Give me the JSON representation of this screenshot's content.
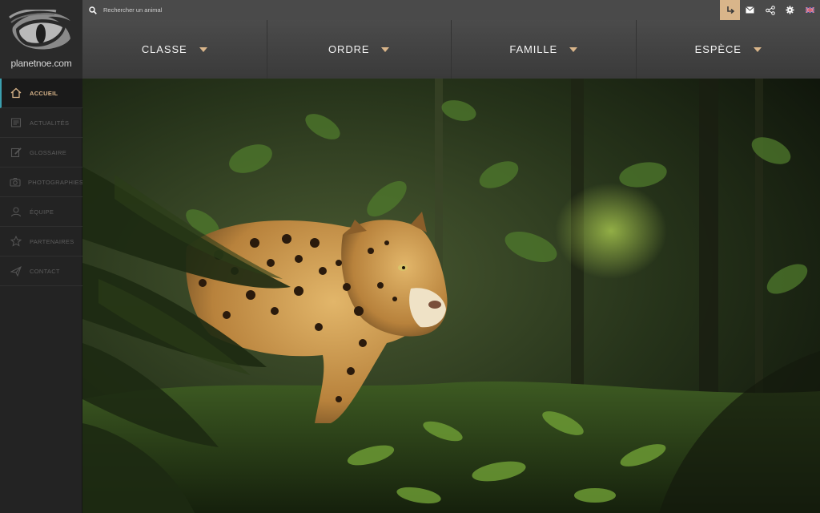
{
  "logo": {
    "text": "planetnoe.com"
  },
  "sidebar": {
    "items": [
      {
        "label": "ACCUEIL",
        "icon": "home-icon",
        "active": true
      },
      {
        "label": "ACTUALITÉS",
        "icon": "news-icon"
      },
      {
        "label": "GLOSSAIRE",
        "icon": "edit-icon"
      },
      {
        "label": "PHOTOGRAPHIES",
        "icon": "camera-icon"
      },
      {
        "label": "ÉQUIPE",
        "icon": "user-icon"
      },
      {
        "label": "PARTENAIRES",
        "icon": "star-icon"
      },
      {
        "label": "CONTACT",
        "icon": "send-icon"
      }
    ]
  },
  "search": {
    "placeholder": "Rechercher un animal"
  },
  "tools": {
    "icons": [
      "back-arrow-icon",
      "mail-icon",
      "share-icon",
      "gear-icon",
      "uk-flag-icon"
    ]
  },
  "taxonomy": {
    "items": [
      {
        "label": "CLASSE"
      },
      {
        "label": "ORDRE"
      },
      {
        "label": "FAMILLE"
      },
      {
        "label": "ESPÈCE"
      }
    ]
  },
  "colors": {
    "accent": "#d9b58a",
    "active_border": "#3b9fae",
    "sidebar_bg": "#232323",
    "topbar_bg": "#4a4a4a"
  },
  "hero": {
    "subject": "jaguar-in-jungle-photo"
  }
}
